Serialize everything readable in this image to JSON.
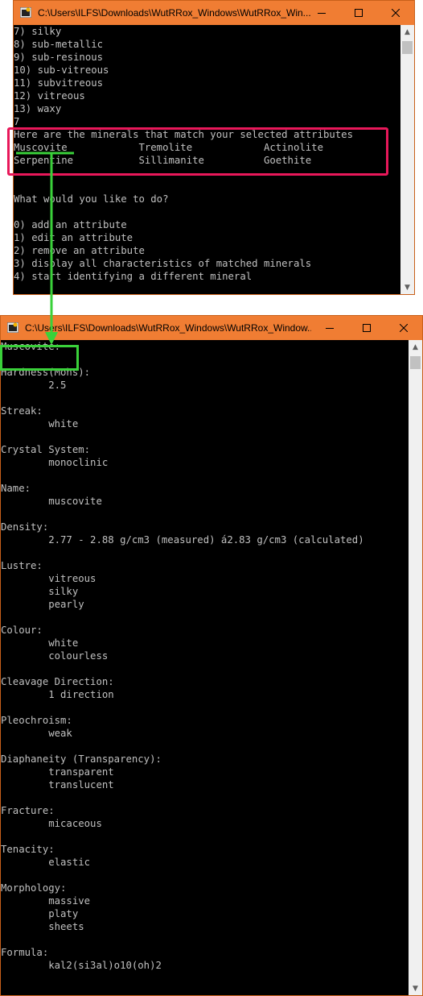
{
  "window1": {
    "title": "C:\\Users\\ILFS\\Downloads\\WutRRox_Windows\\WutRRox_Win...",
    "console_lines": [
      "7) silky",
      "8) sub-metallic",
      "9) sub-resinous",
      "10) sub-vitreous",
      "11) subvitreous",
      "12) vitreous",
      "13) waxy",
      "7",
      "Here are the minerals that match your selected attributes",
      "Muscovite            Tremolite            Actinolite",
      "Serpentine           Sillimanite          Goethite",
      "",
      "",
      "What would you like to do?",
      "",
      "0) add an attribute",
      "1) edit an attribute",
      "2) remove an attribute",
      "3) display all characteristics of matched minerals",
      "4) start identifying a different mineral"
    ]
  },
  "window2": {
    "title": "C:\\Users\\ILFS\\Downloads\\WutRRox_Windows\\WutRRox_Window...",
    "console_lines": [
      "Muscovite:",
      "",
      "Hardness(Mohs):",
      "        2.5",
      "",
      "Streak:",
      "        white",
      "",
      "Crystal System:",
      "        monoclinic",
      "",
      "Name:",
      "        muscovite",
      "",
      "Density:",
      "        2.77 - 2.88 g/cm3 (measured) á2.83 g/cm3 (calculated)",
      "",
      "Lustre:",
      "        vitreous",
      "        silky",
      "        pearly",
      "",
      "Colour:",
      "        white",
      "        colourless",
      "",
      "Cleavage Direction:",
      "        1 direction",
      "",
      "Pleochroism:",
      "        weak",
      "",
      "Diaphaneity (Transparency):",
      "        transparent",
      "        translucent",
      "",
      "Fracture:",
      "        micaceous",
      "",
      "Tenacity:",
      "        elastic",
      "",
      "Morphology:",
      "        massive",
      "        platy",
      "        sheets",
      "",
      "Formula:",
      "        kal2(si3al)o10(oh)2"
    ]
  },
  "controls": {
    "minimize_icon": "minimize-icon",
    "maximize_icon": "maximize-icon",
    "close_icon": "close-icon",
    "scroll_up": "▲",
    "scroll_down": "▼"
  },
  "annotations": {
    "highlight_red_color": "#e8185a",
    "highlight_green_color": "#3ad13a"
  }
}
